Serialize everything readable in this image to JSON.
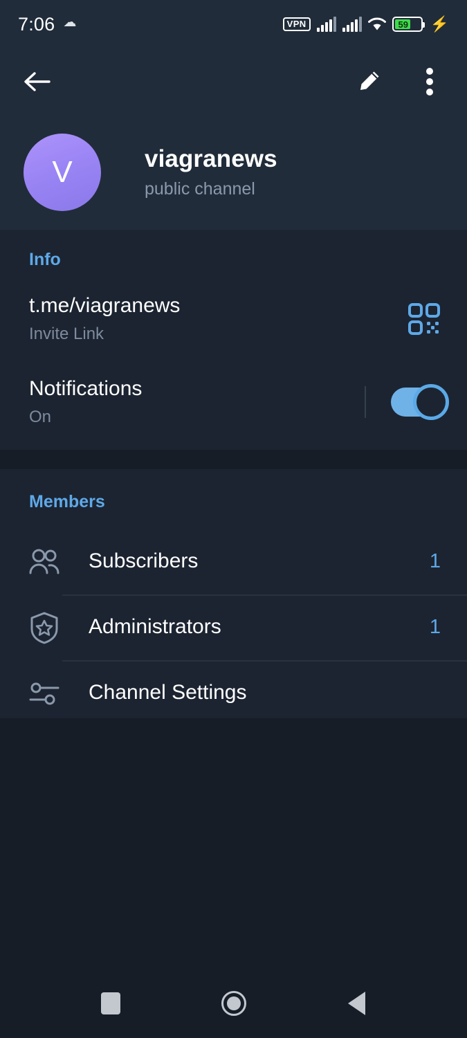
{
  "status_bar": {
    "time": "7:06",
    "weather_glyph": "☁",
    "vpn_label": "VPN",
    "battery_percent": "59",
    "charging_glyph": "⚡",
    "icons": [
      "weather-icon",
      "vpn-badge",
      "signal-icon",
      "signal-icon",
      "wifi-icon",
      "battery-icon",
      "charging-bolt-icon"
    ]
  },
  "toolbar": {
    "back_icon": "back-arrow-icon",
    "edit_icon": "pencil-icon",
    "menu_icon": "overflow-menu-icon"
  },
  "profile": {
    "avatar_letter": "V",
    "title": "viagranews",
    "subtitle": "public channel"
  },
  "info": {
    "section_label": "Info",
    "invite": {
      "value": "t.me/viagranews",
      "label": "Invite Link",
      "action_icon": "qr-code-icon"
    },
    "notifications": {
      "title": "Notifications",
      "state": "On",
      "toggle_on": true
    }
  },
  "members": {
    "section_label": "Members",
    "rows": [
      {
        "icon": "people-icon",
        "label": "Subscribers",
        "count": "1"
      },
      {
        "icon": "shield-star-icon",
        "label": "Administrators",
        "count": "1"
      },
      {
        "icon": "tune-sliders-icon",
        "label": "Channel Settings",
        "count": ""
      }
    ]
  },
  "navbar": {
    "recents_label": "Recents",
    "home_label": "Home",
    "back_label": "Back"
  },
  "colors": {
    "page_bg": "#161d27",
    "header_bg": "#212c3a",
    "card_bg": "#1c2431",
    "accent_blue": "#5ea9e8",
    "text_primary": "#ffffff",
    "text_secondary": "#7d8b9d",
    "avatar_gradient_top": "#ad93fb",
    "avatar_gradient_bottom": "#8a78e9",
    "battery_green": "#3ddc4a",
    "divider": "#29323f"
  }
}
